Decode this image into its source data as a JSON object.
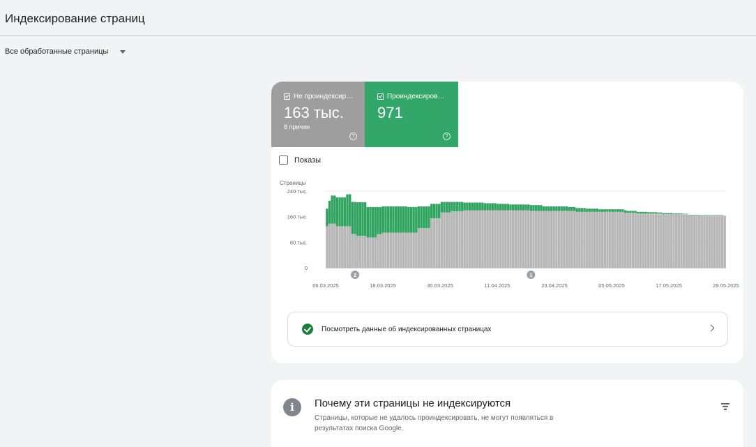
{
  "header": {
    "title": "Индексирование страниц"
  },
  "filter": {
    "selected": "Все обработанные страницы"
  },
  "tiles": {
    "not_indexed": {
      "label": "Не проиндексир…",
      "value": "163 тыс.",
      "sub": "8 причин",
      "color": "#9e9e9e"
    },
    "indexed": {
      "label": "Проиндексиров…",
      "value": "971",
      "color": "#33a669"
    }
  },
  "impressions": {
    "label": "Показы",
    "checked": false
  },
  "chart_data": {
    "type": "bar",
    "stacked": true,
    "ylabel": "Страницы",
    "ylim": [
      0,
      240000
    ],
    "ytick_values": [
      0,
      80000,
      160000,
      240000
    ],
    "ytick_labels": [
      "0",
      "80 тыс.",
      "160 тыс.",
      "240 тыс."
    ],
    "xtick_labels": [
      "06.03.2025",
      "18.03.2025",
      "30.03.2025",
      "11.04.2025",
      "23.04.2025",
      "05.05.2025",
      "17.05.2025",
      "29.05.2025"
    ],
    "annotations": [
      {
        "label": "2",
        "category_index": 11
      },
      {
        "label": "1",
        "category_index": 80
      }
    ],
    "series": [
      {
        "name": "Не проиндексированные",
        "color": "#b7b7b7",
        "values": [
          130000,
          138000,
          138000,
          138000,
          130000,
          130000,
          130000,
          130000,
          130000,
          130000,
          106000,
          106000,
          100000,
          100000,
          100000,
          100000,
          95000,
          95000,
          95000,
          95000,
          105000,
          105000,
          110000,
          110000,
          110000,
          110000,
          110000,
          110000,
          110000,
          110000,
          110000,
          110000,
          110000,
          110000,
          110000,
          110000,
          124000,
          124000,
          124000,
          124000,
          124000,
          155000,
          155000,
          155000,
          155000,
          173000,
          173000,
          173000,
          173000,
          177000,
          177000,
          177000,
          177000,
          177000,
          180000,
          180000,
          180000,
          180000,
          180000,
          180000,
          180000,
          180000,
          180000,
          180000,
          180000,
          180000,
          180000,
          180000,
          180000,
          180000,
          180000,
          180000,
          180000,
          180000,
          180000,
          180000,
          180000,
          180000,
          180000,
          180000,
          178000,
          178000,
          178000,
          178000,
          178000,
          178000,
          178000,
          178000,
          178000,
          178000,
          178000,
          178000,
          178000,
          178000,
          178000,
          178000,
          178000,
          178000,
          175000,
          175000,
          175000,
          175000,
          175000,
          175000,
          175000,
          175000,
          175000,
          175000,
          175000,
          175000,
          175000,
          175000,
          175000,
          175000,
          175000,
          175000,
          175000,
          172000,
          172000,
          172000,
          172000,
          172000,
          170000,
          170000,
          170000,
          170000,
          170000,
          170000,
          170000,
          170000,
          170000,
          170000,
          168000,
          168000,
          168000,
          168000,
          168000,
          168000,
          168000,
          168000,
          168000,
          168000,
          165000,
          165000,
          165000,
          165000,
          165000,
          164000,
          164000,
          164000,
          164000,
          164000,
          164000,
          164000,
          164000,
          164000,
          163000
        ]
      },
      {
        "name": "Проиндексированные",
        "color": "#2fa45f",
        "values": [
          55000,
          72000,
          88000,
          88000,
          90000,
          90000,
          90000,
          90000,
          100000,
          100000,
          100000,
          100000,
          105000,
          105000,
          105000,
          105000,
          95000,
          95000,
          95000,
          95000,
          85000,
          85000,
          82000,
          82000,
          82000,
          82000,
          82000,
          82000,
          82000,
          82000,
          82000,
          82000,
          80000,
          80000,
          80000,
          80000,
          68000,
          68000,
          68000,
          68000,
          68000,
          45000,
          45000,
          45000,
          45000,
          33000,
          33000,
          33000,
          33000,
          29000,
          29000,
          29000,
          29000,
          29000,
          24000,
          24000,
          24000,
          24000,
          24000,
          24000,
          24000,
          24000,
          22000,
          22000,
          22000,
          22000,
          22000,
          20000,
          20000,
          20000,
          20000,
          20000,
          18000,
          18000,
          18000,
          18000,
          18000,
          18000,
          18000,
          18000,
          18000,
          18000,
          18000,
          18000,
          18000,
          14000,
          14000,
          14000,
          14000,
          14000,
          14000,
          14000,
          14000,
          14000,
          14000,
          12000,
          12000,
          12000,
          12000,
          12000,
          12000,
          12000,
          10000,
          10000,
          10000,
          10000,
          10000,
          8000,
          8000,
          8000,
          8000,
          8000,
          8000,
          8000,
          8000,
          8000,
          8000,
          8000,
          6000,
          6000,
          6000,
          6000,
          5000,
          5000,
          5000,
          5000,
          4000,
          4000,
          4000,
          4000,
          3000,
          3000,
          3000,
          3000,
          3000,
          3000,
          2000,
          2000,
          2000,
          2000,
          1000,
          1000,
          1000,
          1000,
          1000,
          1000,
          1000,
          1000,
          1000,
          1000,
          1000,
          1000,
          1000,
          1000,
          1000,
          971
        ]
      }
    ]
  },
  "link": {
    "label": "Посмотреть данные об индексированных страницах"
  },
  "reasons": {
    "title": "Почему эти страницы не индексируются",
    "desc": "Страницы, которые не удалось проиндексировать, не могут появляться в результатах поиска Google."
  }
}
